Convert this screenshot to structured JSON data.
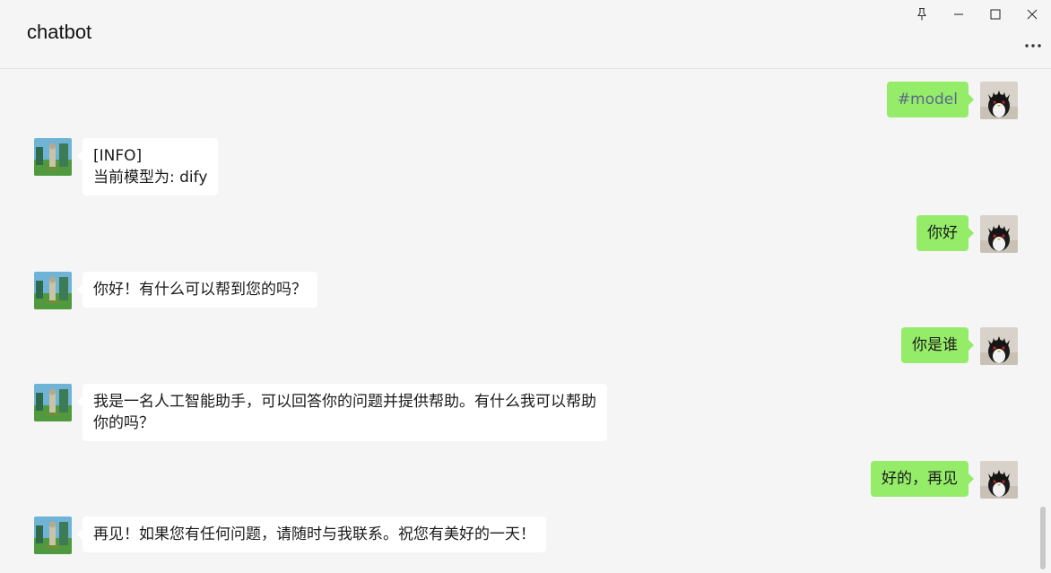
{
  "window": {
    "title": "chatbot"
  },
  "icons": {
    "pin": "pin-icon",
    "minimize": "minimize-icon",
    "maximize": "maximize-icon",
    "close": "close-icon",
    "more": "more-icon"
  },
  "colors": {
    "user_bubble": "#95ec69",
    "bot_bubble": "#ffffff",
    "background": "#f5f5f5"
  },
  "messages": [
    {
      "role": "user",
      "text": "#model"
    },
    {
      "role": "bot",
      "text": "[INFO]\n当前模型为: dify"
    },
    {
      "role": "user",
      "text": "你好"
    },
    {
      "role": "bot",
      "text": "你好！有什么可以帮到您的吗？"
    },
    {
      "role": "user",
      "text": "你是谁"
    },
    {
      "role": "bot",
      "text": "我是一名人工智能助手，可以回答你的问题并提供帮助。有什么我可以帮助\n你的吗？"
    },
    {
      "role": "user",
      "text": "好的，再见"
    },
    {
      "role": "bot",
      "text": "再见！如果您有任何问题，请随时与我联系。祝您有美好的一天！"
    }
  ]
}
